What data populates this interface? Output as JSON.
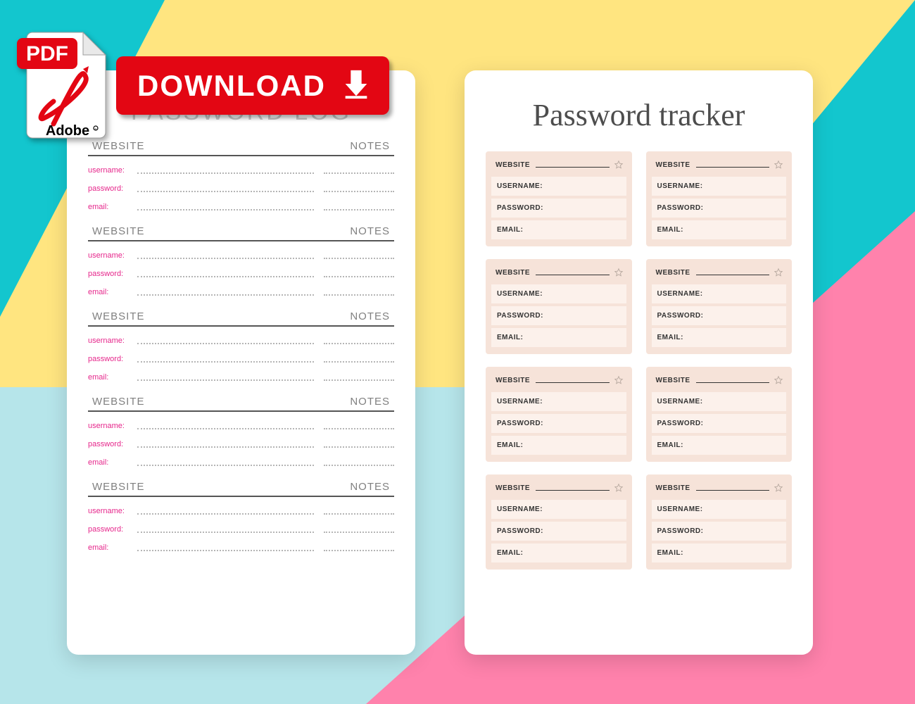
{
  "overlay": {
    "pdf_badge_text": "PDF",
    "pdf_brand": "Adobe",
    "download_label": "DOWNLOAD"
  },
  "left_card": {
    "title": "PASSWORD LOG",
    "header_website": "WEBSITE",
    "header_notes": "NOTES",
    "field_username": "username:",
    "field_password": "password:",
    "field_email": "email:",
    "entry_count": 5
  },
  "right_card": {
    "title": "Password tracker",
    "label_website": "WEBSITE",
    "label_username": "USERNAME:",
    "label_password": "PASSWORD:",
    "label_email": "EMAIL:",
    "cell_count": 8
  },
  "colors": {
    "accent_pink": "#e6268b",
    "bg_teal": "#13c6ce",
    "bg_yellow": "#ffe580",
    "bg_pink": "#ff82ac",
    "bg_ltblue": "#b6e5ea",
    "download_red": "#e30613"
  }
}
